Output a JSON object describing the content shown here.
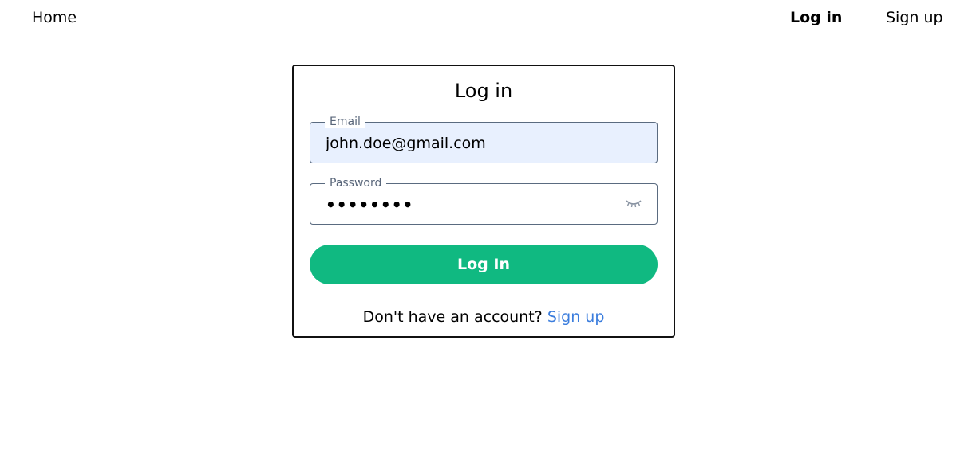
{
  "nav": {
    "home_label": "Home",
    "login_label": "Log in",
    "signup_label": "Sign up"
  },
  "card": {
    "title": "Log in",
    "email": {
      "legend": "Email",
      "value": "john.doe@gmail.com"
    },
    "password": {
      "legend": "Password",
      "masked_value": "••••••••"
    },
    "submit_label": "Log In",
    "footer_prompt": "Don't have an account? ",
    "footer_link": "Sign up"
  },
  "icons": {
    "password_toggle": "eye-closed-icon"
  },
  "colors": {
    "accent": "#10b981",
    "link": "#3b7ddd",
    "autofill_bg": "#e8f0fe"
  }
}
